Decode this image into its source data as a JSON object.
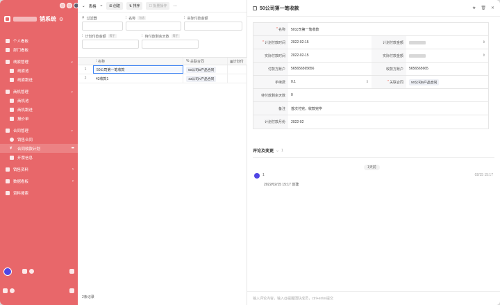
{
  "sidebar": {
    "app_title": "销系统",
    "items": [
      {
        "label": "个人看板",
        "type": "item"
      },
      {
        "label": "部门看板",
        "type": "item"
      },
      {
        "label": "线索管理",
        "type": "group",
        "chev": "⌄"
      },
      {
        "label": "线索池",
        "type": "sub"
      },
      {
        "label": "线索跟进",
        "type": "sub"
      },
      {
        "label": "商机管理",
        "type": "group",
        "chev": "⌄"
      },
      {
        "label": "商机池",
        "type": "sub"
      },
      {
        "label": "商机跟进",
        "type": "sub"
      },
      {
        "label": "报价单",
        "type": "sub"
      },
      {
        "label": "合同管理",
        "type": "group",
        "chev": "⌄"
      },
      {
        "label": "销售合同",
        "type": "sub"
      },
      {
        "label": "合同收款计划",
        "type": "sub-active"
      },
      {
        "label": "开票信息",
        "type": "sub"
      },
      {
        "label": "销售资料",
        "type": "group",
        "chev": "›"
      },
      {
        "label": "数据看板",
        "type": "group",
        "chev": "›"
      },
      {
        "label": "资料搜索",
        "type": "item"
      }
    ]
  },
  "toolbar": {
    "view_label": "表格",
    "create_label": "创建",
    "sort_label": "排序",
    "batch_label": "批量操作",
    "more_label": "⋯"
  },
  "filters": {
    "filter_label": "过滤器",
    "name_label": "名称",
    "name_tag": "包含",
    "paid_amount_label": "实际付款金额",
    "plan_amount_label": "计划付款金额",
    "plan_amount_tag": "等于",
    "pending_days_label": "待付款剩余天数",
    "pending_days_tag": "等于"
  },
  "table": {
    "columns": [
      "名称",
      "关联合同",
      "计划付"
    ],
    "rows": [
      {
        "num": "1",
        "name": "50公司第一笔收款",
        "contract": "50公司B产品合同"
      },
      {
        "num": "2",
        "name": "43收款1",
        "contract": "43公司A产品合同"
      }
    ],
    "count_label": "2条记录"
  },
  "detail": {
    "title": "50公司第一笔收款",
    "fields": {
      "name_label": "名称",
      "name_value": "50公司第一笔收款",
      "plan_time_label": "计划付款时间",
      "plan_time_value": "2022-02-15",
      "plan_amount_label": "计划付款金额",
      "actual_time_label": "实际付款时间",
      "actual_time_value": "2022-02-15",
      "actual_amount_label": "实际付款金额",
      "payer_account_label": "付款方账户",
      "payer_account_value": "565656565656",
      "payee_account_label": "收款方账户",
      "payee_account_value": "5656565665",
      "fee_label": "手续费",
      "fee_value": "0.1",
      "contract_label": "关联合同",
      "contract_value": "50公司B产品合同",
      "pending_label": "待付款剩余天数",
      "pending_value": "0",
      "note_label": "备注",
      "note_value": "首次付完，收款完毕",
      "plan_month_label": "计划付款月份",
      "plan_month_value": "2022-02"
    },
    "comments_label": "评论及变更",
    "comments_count": "1",
    "day_pill": "1天前",
    "comment_user": "1",
    "comment_time": "02/15 15:17",
    "comment_body": "2022/02/15 15:17 创建",
    "input_placeholder": "输入评论内容，输入@提醒团队成员，ctrl+enter提交"
  }
}
